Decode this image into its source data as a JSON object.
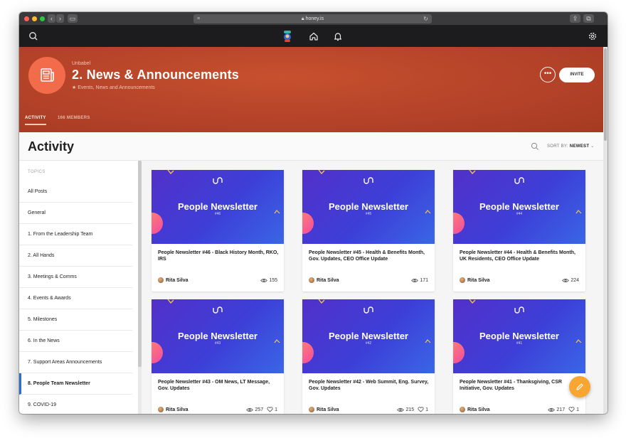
{
  "browser": {
    "url": "honey.is",
    "colors": {
      "close": "#ff5f57",
      "minimize": "#febc2e",
      "zoom": "#28c840"
    }
  },
  "appbar": {
    "icons": [
      "search-icon",
      "avatar",
      "home-icon",
      "bell-icon",
      "settings-icon"
    ]
  },
  "hero": {
    "org": "Unbabel",
    "title": "2. News & Announcements",
    "subtitle": "★ Events, News and Announcements",
    "more_label": "•••",
    "invite_label": "INVITE",
    "tabs": [
      {
        "label": "ACTIVITY",
        "active": true
      },
      {
        "label": "166 MEMBERS",
        "active": false
      }
    ],
    "color": "#b8452a"
  },
  "activity": {
    "title": "Activity",
    "sort_prefix": "SORT BY:",
    "sort_value": "NEWEST"
  },
  "sidebar": {
    "topics_label": "TOPICS",
    "items": [
      {
        "label": "All Posts"
      },
      {
        "label": "General"
      },
      {
        "label": "1. From the Leadership Team"
      },
      {
        "label": "2. All Hands"
      },
      {
        "label": "3. Meetings & Comms"
      },
      {
        "label": "4. Events & Awards"
      },
      {
        "label": "5. Milestones"
      },
      {
        "label": "6. In the News"
      },
      {
        "label": "7. Support Areas Announcements"
      },
      {
        "label": "8. People Team Newsletter",
        "active": true
      },
      {
        "label": "9. COVID-19"
      }
    ],
    "active_color": "#2b6fd1"
  },
  "cards": [
    {
      "image_title": "People Newsletter",
      "image_num": "#46",
      "title": "People Newsletter #46 - Black History Month, RKO, IRS",
      "author": "Rita Silva",
      "views": "155",
      "likes": ""
    },
    {
      "image_title": "People Newsletter",
      "image_num": "#45",
      "title": "People Newsletter #45 - Health & Benefits Month, Gov. Updates, CEO Office Update",
      "author": "Rita Silva",
      "views": "171",
      "likes": ""
    },
    {
      "image_title": "People Newsletter",
      "image_num": "#44",
      "title": "People Newsletter #44 - Health & Benefits Month, UK Residents, CEO Office Update",
      "author": "Rita Silva",
      "views": "224",
      "likes": ""
    },
    {
      "image_title": "People Newsletter",
      "image_num": "#43",
      "title": "People Newsletter #43 - OM News, LT Message, Gov. Updates",
      "author": "Rita Silva",
      "views": "257",
      "likes": "1"
    },
    {
      "image_title": "People Newsletter",
      "image_num": "#42",
      "title": "People Newsletter #42 - Web Summit, Eng. Survey, Gov. Updates",
      "author": "Rita Silva",
      "views": "215",
      "likes": "1"
    },
    {
      "image_title": "People Newsletter",
      "image_num": "#41",
      "title": "People Newsletter #41 - Thanksgiving, CSR Initiative, Gov. Updates",
      "author": "Rita Silva",
      "views": "217",
      "likes": "1"
    }
  ],
  "fab": {
    "icon": "pencil-icon",
    "color": "#f8a531"
  }
}
